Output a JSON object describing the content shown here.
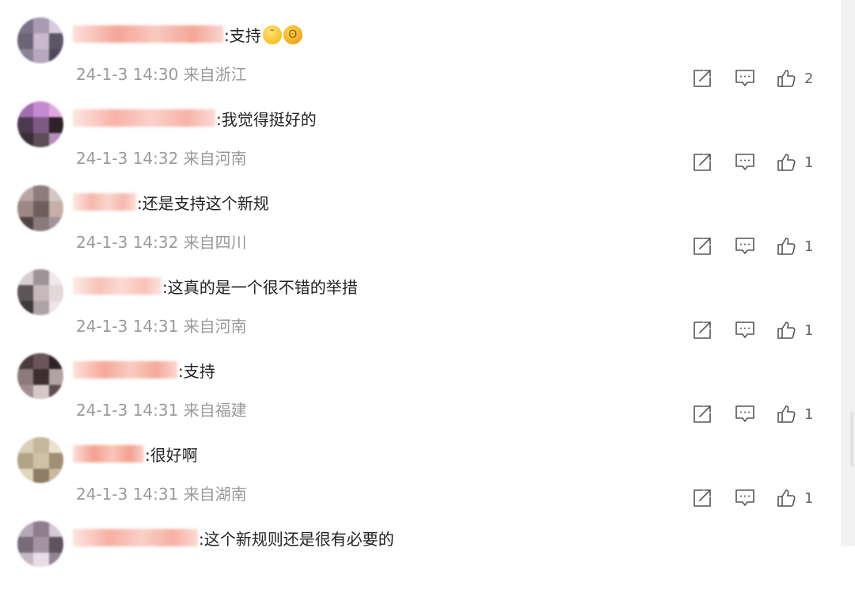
{
  "comments": [
    {
      "text": ":支持",
      "time": "24-1-3 14:30",
      "location": "来自浙江",
      "likes": "2",
      "emojis": [
        "flushed-face-emoji",
        "screaming-face-emoji"
      ],
      "username_color": "#f4a596",
      "avatar_colors": [
        "#7b7187",
        "#a99bb1",
        "#d8cde0",
        "#6a6475",
        "#c9b9cb",
        "#5b5568",
        "#8c8296",
        "#b7a8c0",
        "#4f4a5b"
      ]
    },
    {
      "text": ":我觉得挺好的",
      "time": "24-1-3 14:32",
      "location": "来自河南",
      "likes": "1",
      "emojis": [],
      "username_color": "#f7b2a6",
      "avatar_colors": [
        "#9e6eb0",
        "#c48ad3",
        "#e3a8e0",
        "#4c3a4e",
        "#7d5a84",
        "#2d2227",
        "#3a2f36",
        "#5c4c55",
        "#b58fb9"
      ]
    },
    {
      "text": ":还是支持这个新规",
      "time": "24-1-3 14:32",
      "location": "来自四川",
      "likes": "1",
      "emojis": [],
      "username_color": "#f6b8ad",
      "avatar_colors": [
        "#b9a6a6",
        "#8f7d7d",
        "#d4c7c3",
        "#9e8884",
        "#6f5f5c",
        "#c4b0a6",
        "#4e4345",
        "#8a7a7c",
        "#a39596"
      ]
    },
    {
      "text": ":这真的是一个很不错的举措",
      "time": "24-1-3 14:31",
      "location": "来自河南",
      "likes": "1",
      "emojis": [],
      "username_color": "#f8c2b8",
      "avatar_colors": [
        "#d9cfd1",
        "#9e9396",
        "#f0e8ea",
        "#5b5557",
        "#c7b8bb",
        "#e2d8da",
        "#3c3739",
        "#b0a3a6",
        "#efe4e6"
      ]
    },
    {
      "text": ":支持",
      "time": "24-1-3 14:31",
      "location": "来自福建",
      "likes": "1",
      "emojis": [],
      "username_color": "#f5a999",
      "avatar_colors": [
        "#4a3b3d",
        "#6b5658",
        "#2e2426",
        "#8d7a7c",
        "#3d2f31",
        "#b4a3a5",
        "#a08d8f",
        "#d6c8ca",
        "#5e4e50"
      ]
    },
    {
      "text": ":很好啊",
      "time": "24-1-3 14:31",
      "location": "来自湖南",
      "likes": "1",
      "emojis": [],
      "username_color": "#f4a08e",
      "avatar_colors": [
        "#d9d0ba",
        "#c4b79a",
        "#eae2cf",
        "#b2a487",
        "#cfc2a3",
        "#a08f75",
        "#e0d6c0",
        "#8e7d66",
        "#c9ba9b"
      ]
    },
    {
      "text": ":这个新规则还是很有必要的",
      "time": "",
      "location": "",
      "likes": "",
      "emojis": [],
      "username_color": "#f6b0a2",
      "avatar_colors": [
        "#b6a7b6",
        "#8d7d8d",
        "#d5c9d5",
        "#7a6a7a",
        "#a394a3",
        "#5f535f",
        "#c5b8c5",
        "#e6dde6",
        "#948594"
      ]
    }
  ]
}
